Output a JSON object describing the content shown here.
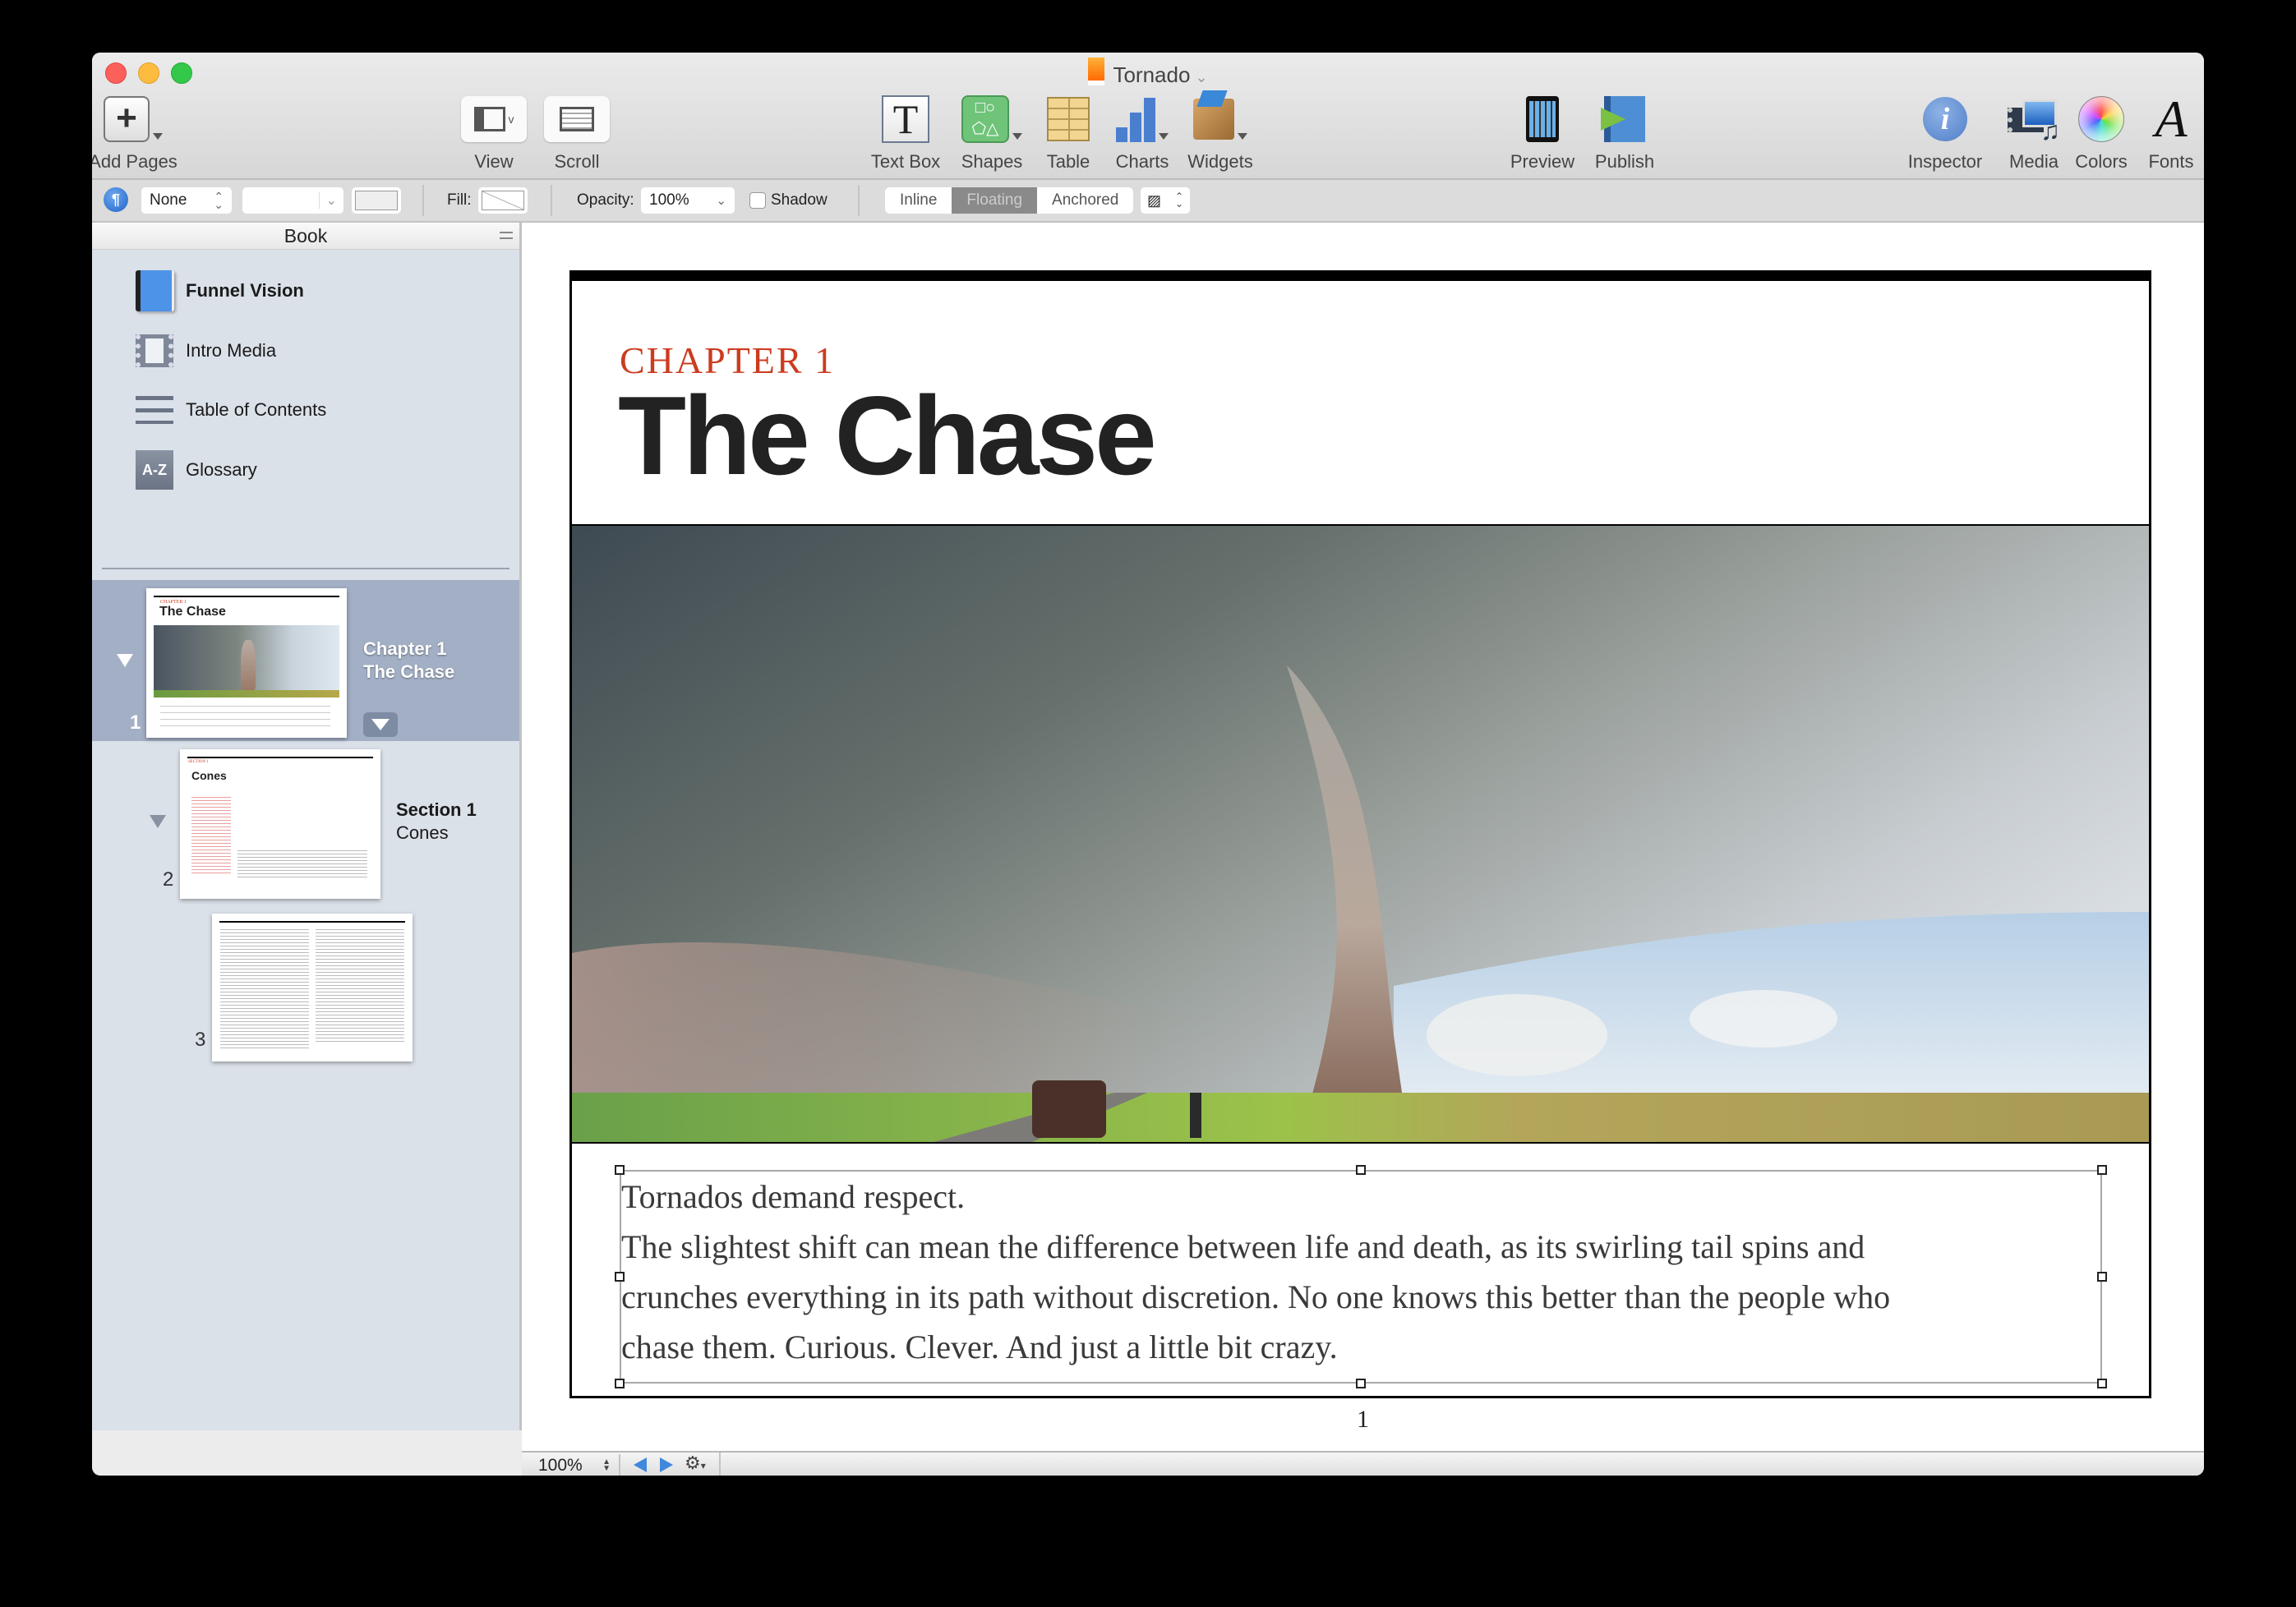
{
  "window": {
    "title": "Tornado",
    "traffic_lights": [
      "close",
      "minimize",
      "zoom"
    ]
  },
  "toolbar": {
    "add_pages": "Add Pages",
    "view": "View",
    "scroll": "Scroll",
    "text_box": "Text Box",
    "shapes": "Shapes",
    "table": "Table",
    "charts": "Charts",
    "widgets": "Widgets",
    "preview": "Preview",
    "publish": "Publish",
    "inspector": "Inspector",
    "media": "Media",
    "colors": "Colors",
    "fonts": "Fonts"
  },
  "format_bar": {
    "paragraph_style": "None",
    "fill_label": "Fill:",
    "opacity_label": "Opacity:",
    "opacity_value": "100%",
    "shadow_label": "Shadow",
    "shadow_checked": false,
    "placement": {
      "options": [
        "Inline",
        "Floating",
        "Anchored"
      ],
      "selected": "Floating"
    }
  },
  "sidebar": {
    "header": "Book",
    "items": [
      {
        "label": "Funnel Vision",
        "icon": "book-icon",
        "bold": true
      },
      {
        "label": "Intro Media",
        "icon": "film-icon"
      },
      {
        "label": "Table of Contents",
        "icon": "list-icon"
      },
      {
        "label": "Glossary",
        "icon": "glossary-icon",
        "icon_text": "A-Z"
      }
    ],
    "pages": [
      {
        "number": "1",
        "line1": "Chapter 1",
        "line2": "The Chase",
        "selected": true,
        "thumb_label": "CHAPTER 1",
        "thumb_title": "The Chase"
      },
      {
        "number": "2",
        "line1": "Section 1",
        "line2": "Cones",
        "selected": false,
        "thumb_label": "SECTION 1",
        "thumb_title": "Cones"
      },
      {
        "number": "3",
        "line1": "",
        "line2": "",
        "selected": false
      }
    ]
  },
  "document": {
    "chapter_label": "CHAPTER 1",
    "chapter_title": "The Chase",
    "body_lines": [
      "Tornados demand respect.",
      "The slightest shift can mean the difference between life and death, as its swirling tail spins and",
      "crunches everything in its path without discretion. No one knows this better than the people who",
      "chase them. Curious. Clever. And just a little bit crazy."
    ],
    "page_number": "1",
    "accent_color": "#cc3b1f"
  },
  "status_bar": {
    "zoom": "100%"
  }
}
